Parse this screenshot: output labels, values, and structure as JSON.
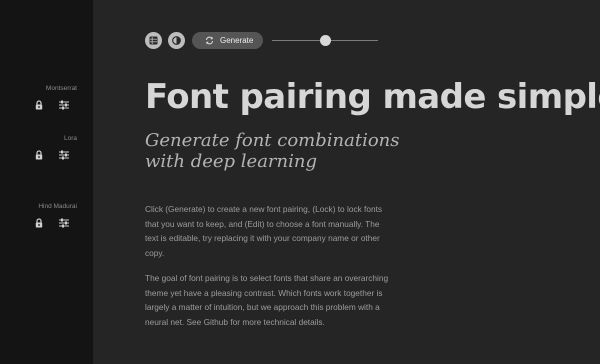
{
  "sidebar": {
    "fonts": [
      {
        "name": "Montserrat",
        "lock_icon": "lock-icon",
        "edit_icon": "sliders-icon"
      },
      {
        "name": "Lora",
        "lock_icon": "lock-icon",
        "edit_icon": "sliders-icon"
      },
      {
        "name": "Hind Madurai",
        "lock_icon": "lock-icon",
        "edit_icon": "sliders-icon"
      }
    ]
  },
  "toolbar": {
    "layout_icon": "list-view-icon",
    "theme_icon": "contrast-icon",
    "generate_icon": "refresh-icon",
    "generate_label": "Generate",
    "slider_value": 0.5
  },
  "content": {
    "headline": "Font pairing made simple",
    "subheading": "Generate font combinations with deep learning",
    "paragraphs": [
      "Click (Generate) to create a new font pairing, (Lock) to lock fonts that you want to keep, and (Edit) to choose a font manually. The text is editable, try replacing it with your company name or other copy.",
      "The goal of font pairing is to select fonts that share an overarching theme yet have a pleasing contrast. Which fonts work together is largely a matter of intuition, but we approach this problem with a neural net. See Github for more technical details."
    ]
  },
  "colors": {
    "background": "#252525",
    "sidebar": "#141414",
    "headline": "#d6d6d6",
    "body_text": "#9c9c9c",
    "button": "#555555"
  }
}
